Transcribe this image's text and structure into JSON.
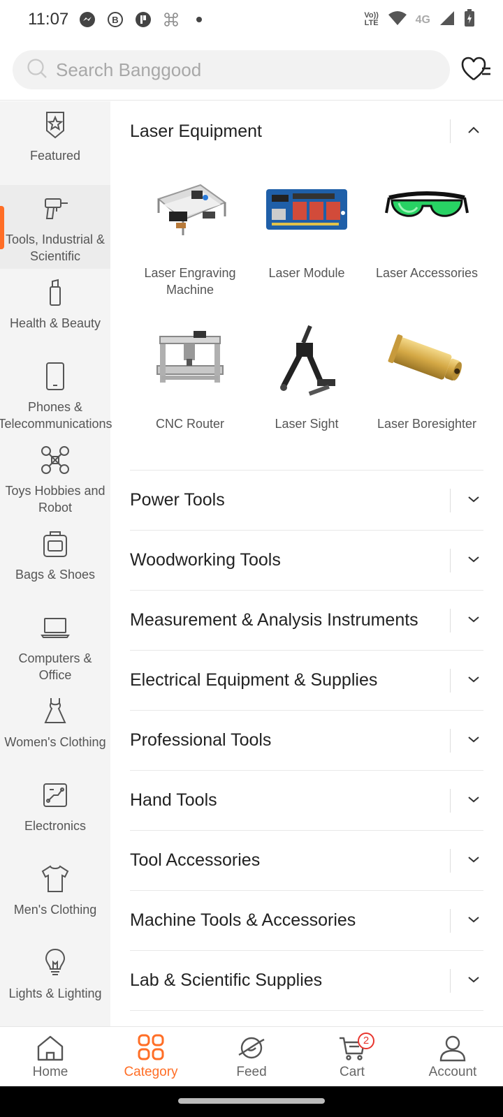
{
  "status_bar": {
    "time": "11:07",
    "volte": "Vo)) LTE",
    "network": "4G"
  },
  "search": {
    "placeholder": "Search Banggood"
  },
  "sidebar": {
    "items": [
      {
        "label": "Featured",
        "icon": "star-badge-icon"
      },
      {
        "label": "Tools, Industrial & Scientific",
        "icon": "drill-icon",
        "active": true
      },
      {
        "label": "Health & Beauty",
        "icon": "lipstick-icon"
      },
      {
        "label": "Phones & Telecommunications",
        "icon": "phone-icon"
      },
      {
        "label": "Toys Hobbies and Robot",
        "icon": "drone-icon"
      },
      {
        "label": "Bags & Shoes",
        "icon": "bag-icon"
      },
      {
        "label": "Computers & Office",
        "icon": "laptop-icon"
      },
      {
        "label": "Women's Clothing",
        "icon": "dress-icon"
      },
      {
        "label": "Electronics",
        "icon": "circuit-icon"
      },
      {
        "label": "Men's Clothing",
        "icon": "shirt-icon"
      },
      {
        "label": "Lights & Lighting",
        "icon": "bulb-icon"
      }
    ]
  },
  "main": {
    "expanded": {
      "title": "Laser Equipment",
      "subitems": [
        {
          "label": "Laser Engraving Machine"
        },
        {
          "label": "Laser Module"
        },
        {
          "label": "Laser Accessories"
        },
        {
          "label": "CNC Router"
        },
        {
          "label": "Laser Sight"
        },
        {
          "label": "Laser Boresighter"
        }
      ]
    },
    "categories": [
      "Power Tools",
      "Woodworking Tools",
      "Measurement & Analysis Instruments",
      "Electrical Equipment & Supplies",
      "Professional Tools",
      "Hand Tools",
      "Tool Accessories",
      "Machine Tools & Accessories",
      "Lab & Scientific Supplies"
    ]
  },
  "bottom_nav": {
    "items": [
      {
        "label": "Home"
      },
      {
        "label": "Category",
        "active": true
      },
      {
        "label": "Feed"
      },
      {
        "label": "Cart",
        "badge": "2"
      },
      {
        "label": "Account"
      }
    ]
  },
  "colors": {
    "accent": "#ff6e26",
    "badge": "#e8352e"
  }
}
